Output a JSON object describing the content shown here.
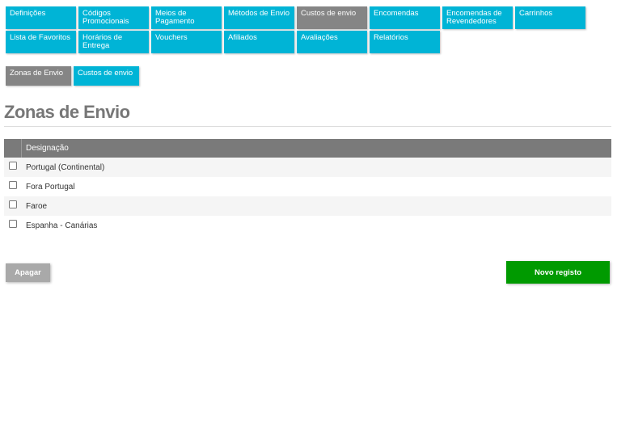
{
  "nav": {
    "items": [
      {
        "label": "Definições",
        "active": false
      },
      {
        "label": "Códigos Promocionais",
        "active": false
      },
      {
        "label": "Meios de Pagamento",
        "active": false
      },
      {
        "label": "Métodos de Envio",
        "active": false
      },
      {
        "label": "Custos de envio",
        "active": true
      },
      {
        "label": "Encomendas",
        "active": false
      },
      {
        "label": "Encomendas de Revendedores",
        "active": false
      },
      {
        "label": "Carrinhos",
        "active": false
      },
      {
        "label": "Lista de Favoritos",
        "active": false
      },
      {
        "label": "Horários de Entrega",
        "active": false
      },
      {
        "label": "Vouchers",
        "active": false
      },
      {
        "label": "Afiliados",
        "active": false
      },
      {
        "label": "Avaliações",
        "active": false
      },
      {
        "label": "Relatórios",
        "active": false
      }
    ]
  },
  "subnav": {
    "items": [
      {
        "label": "Zonas de Envio",
        "active": true
      },
      {
        "label": "Custos de envio",
        "active": false
      }
    ]
  },
  "page": {
    "title": "Zonas de Envio"
  },
  "table": {
    "header": "Designação",
    "rows": [
      {
        "name": "Portugal (Continental)",
        "checked": false
      },
      {
        "name": "Fora Portugal",
        "checked": false
      },
      {
        "name": "Faroe",
        "checked": false
      },
      {
        "name": "Espanha - Canárias",
        "checked": false
      }
    ]
  },
  "actions": {
    "delete_label": "Apagar",
    "new_label": "Novo registo"
  },
  "colors": {
    "accent": "#00b4d6",
    "active_tab": "#858585",
    "header_bg": "#7a7a7a",
    "primary_button": "#009a00",
    "secondary_button": "#a9a9a9"
  }
}
